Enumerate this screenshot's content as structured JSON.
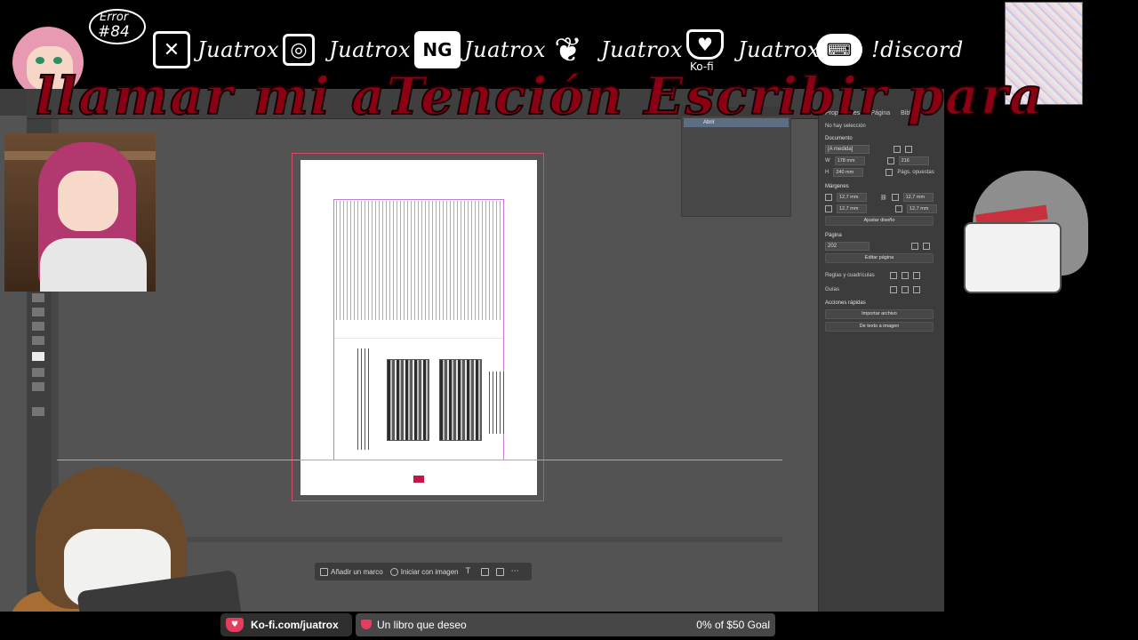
{
  "overlay": {
    "error_badge": {
      "line1": "Error",
      "line2": "#84"
    },
    "socials": [
      {
        "icon": "x-twitter-icon",
        "glyph": "✕",
        "name": "Juatrox"
      },
      {
        "icon": "instagram-icon",
        "glyph": "◎",
        "name": "Juatrox"
      },
      {
        "icon": "newgrounds-icon",
        "glyph": "NG",
        "name": "Juatrox"
      },
      {
        "icon": "bluesky-butterfly-icon",
        "glyph": "❦",
        "name": "Juatrox"
      },
      {
        "icon": "kofi-cup-icon",
        "glyph": "♥",
        "name": "Juatrox"
      },
      {
        "icon": "discord-gamepad-icon",
        "glyph": "⌨",
        "name": "!discord"
      }
    ],
    "kofi_icon_label": "Ko-fi",
    "headline": "llamar mi aTención Escribir para",
    "kofi_link": "Ko-fi.com/juatrox",
    "goal": {
      "title": "Un libro que deseo",
      "progress_text": "0% of $50 Goal",
      "progress_fraction": 0
    }
  },
  "indesign": {
    "mid_panel": {
      "selected_item": "Abrir"
    },
    "properties": {
      "tabs": [
        "Propiedades",
        "Página",
        "Biblioteca"
      ],
      "no_selection": "No hay selección",
      "document_label": "Documento",
      "preset": "[A medida]",
      "width": "178 mm",
      "height": "240 mm",
      "pages": "216",
      "facing_pages": "Págs. opuestas",
      "margins_label": "Márgenes",
      "margin_top": "12,7 mm",
      "margin_bottom": "12,7 mm",
      "margin_left": "12,7 mm",
      "margin_right": "12,7 mm",
      "adjust_layout": "Ajustar diseño",
      "page_label": "Página",
      "page_number": "202",
      "edit_page": "Editar página",
      "rulers_grids": "Reglas y cuadrículas",
      "guides": "Guías",
      "quick_actions": "Acciones rápidas",
      "import_file": "Importar archivo",
      "text_to_image": "De texto a imagen"
    },
    "context_bar": {
      "add_frame": "Añadir un marco",
      "start_with_image": "Iniciar con imagen"
    }
  }
}
